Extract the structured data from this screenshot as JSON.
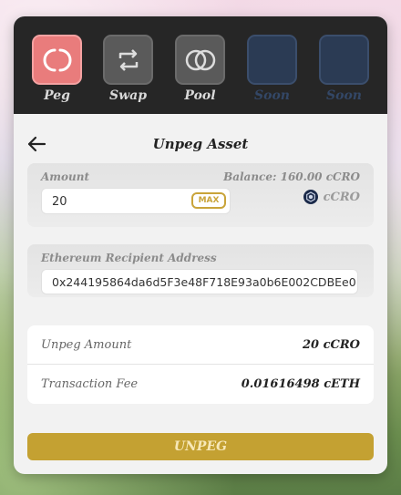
{
  "nav": {
    "items": [
      {
        "label": "Peg",
        "icon": "peg-icon",
        "state": "active"
      },
      {
        "label": "Swap",
        "icon": "swap-icon",
        "state": "normal"
      },
      {
        "label": "Pool",
        "icon": "pool-icon",
        "state": "normal"
      },
      {
        "label": "Soon",
        "icon": "placeholder",
        "state": "disabled"
      },
      {
        "label": "Soon",
        "icon": "placeholder",
        "state": "disabled"
      }
    ]
  },
  "header": {
    "title": "Unpeg Asset"
  },
  "amount": {
    "label": "Amount",
    "balance": "Balance: 160.00 cCRO",
    "value": "20",
    "max_label": "MAX",
    "token": "cCRO"
  },
  "recipient": {
    "label": "Ethereum Recipient Address",
    "value": "0x244195864da6d5F3e48F718E93a0b6E002CDBEe0"
  },
  "summary": {
    "unpeg_amount_label": "Unpeg Amount",
    "unpeg_amount_value": "20 cCRO",
    "fee_label": "Transaction Fee",
    "fee_value": "0.01616498 cETH"
  },
  "action": {
    "label": "UNPEG"
  },
  "colors": {
    "accent": "#c4a132",
    "active_tab": "#e97c7c",
    "topbar": "#262626"
  }
}
